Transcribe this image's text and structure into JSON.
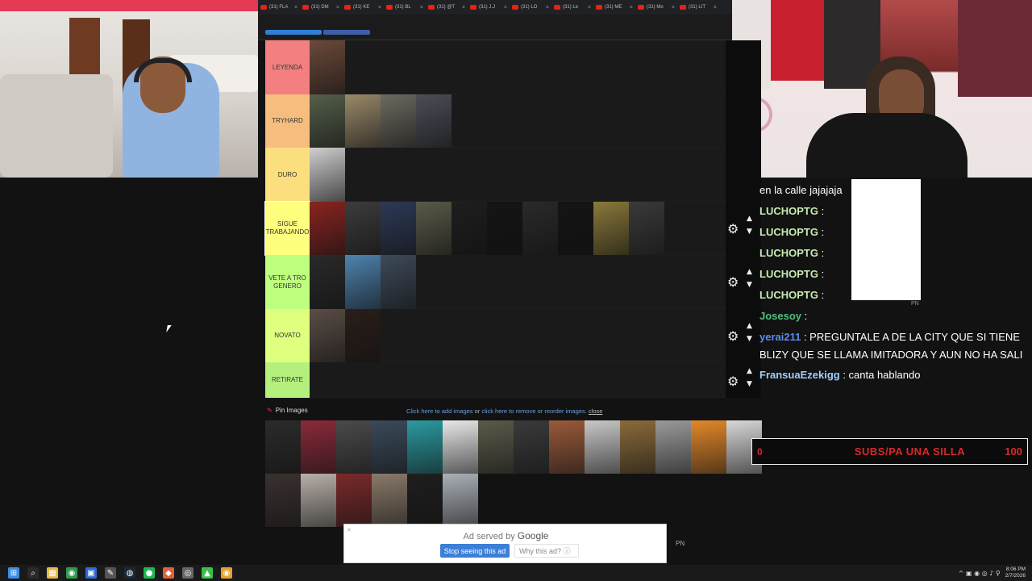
{
  "browser_tabs": [
    {
      "label": "(31) FLA"
    },
    {
      "label": "(31) DM"
    },
    {
      "label": "(31) KE"
    },
    {
      "label": "(31) BL"
    },
    {
      "label": "(31) @T"
    },
    {
      "label": "(31) J.J"
    },
    {
      "label": "(31) LO"
    },
    {
      "label": "(31) Le"
    },
    {
      "label": "(31) ME"
    },
    {
      "label": "(31) Mo"
    },
    {
      "label": "(31) LIT"
    }
  ],
  "tier_rows": [
    {
      "label": "LEYENDA",
      "color": "#f47f80",
      "thumbs": [
        "#6b4a3a"
      ]
    },
    {
      "label": "TRYHARD",
      "color": "#f7bd7f",
      "thumbs": [
        "#555f4a",
        "#9a8a6a",
        "#6d6a60",
        "#4c4e58"
      ]
    },
    {
      "label": "DURO",
      "color": "#fbdf7f",
      "thumbs": [
        "#cfcfcf"
      ]
    },
    {
      "label": "SIGUE TRABAJANDO",
      "color": "#ffff7f",
      "thumbs": [
        "#8a2420",
        "#3c3c3c",
        "#2d3a56",
        "#5a5a4a",
        "#1e1e1e",
        "#141414",
        "#2a2a2a",
        "#141414",
        "#8b7a3a",
        "#3a3a3a"
      ]
    },
    {
      "label": "VETE A TRO GENERO",
      "color": "#bfff7f",
      "thumbs": [
        "#2a2a2a",
        "#4e84b0",
        "#3e4a5a"
      ]
    },
    {
      "label": "NOVATO",
      "color": "#dfff7f",
      "thumbs": [
        "#5a4e46",
        "#2a1e1a"
      ]
    },
    {
      "label": "RETIRATE",
      "color": "#b5f07f",
      "thumbs": []
    }
  ],
  "pin_images": {
    "label": "Pin Images",
    "help_prefix": "Click here to add images",
    "help_or": " or ",
    "help_link": "click here to remove or reorder images.",
    "help_close": "close",
    "pool_thumbs": [
      "#2b2b2b",
      "#8a2a3a",
      "#4a4a4a",
      "#3a4a5a",
      "#2a9aa0",
      "#e8e8e8",
      "#5a5a4a",
      "#3a3a3a",
      "#9a5a3a",
      "#c8c8c8",
      "#8a6a3a",
      "#9a9a9a",
      "#e3882a",
      "#d8d8d8",
      "#3a3030",
      "#b8b0a8",
      "#7a2a2a",
      "#8a7a6a",
      "#1e1e1e",
      "#aab0b8"
    ]
  },
  "chat": {
    "lines": [
      {
        "user": "",
        "msg": "en la calle jajajaja",
        "user_color": "#ffffff"
      },
      {
        "user": "LUCHOPTG",
        "msg": " : ",
        "user_color": "#c5ecb1",
        "emote": true
      },
      {
        "user": "LUCHOPTG",
        "msg": " : ",
        "user_color": "#c5ecb1",
        "emote": true
      },
      {
        "user": "LUCHOPTG",
        "msg": " : ",
        "user_color": "#c5ecb1",
        "emote": true
      },
      {
        "user": "LUCHOPTG",
        "msg": " : ",
        "user_color": "#c5ecb1",
        "emote": true
      },
      {
        "user": "LUCHOPTG",
        "msg": " : ",
        "user_color": "#c5ecb1",
        "emote": true
      },
      {
        "user": "Josesoy",
        "msg": " : ",
        "user_color": "#4fbf7f",
        "emote": true
      },
      {
        "user": "yerai211",
        "msg": " : PREGUNTALE A DE LA CITY QUE SI TIENE",
        "user_color": "#5a8cf0"
      },
      {
        "user": "",
        "msg": "BLIZY QUE SE LLAMA IMITADORA Y AUN NO HA SALI",
        "user_color": "#ffffff"
      },
      {
        "user": "FransuaEzekigg",
        "msg": " : canta hablando",
        "user_color": "#9ed0ff"
      }
    ],
    "pn": "PN"
  },
  "goal": {
    "left": "0",
    "text": "SUBS/PA UNA SILLA",
    "right": "100",
    "color": "#d9282b"
  },
  "ad": {
    "served_by": "Ad served by",
    "google": "Google",
    "stop_label": "Stop seeing this ad",
    "why_label": "Why this ad?",
    "info_icon": "ⓘ",
    "pn": "PN"
  },
  "taskbar": {
    "icons": [
      "start-icon",
      "search-icon",
      "file-explorer-icon",
      "chrome-icon",
      "app-icon",
      "pen-icon",
      "steam-icon",
      "spotify-icon",
      "brave-icon",
      "obs-icon",
      "game-icon",
      "chrome-canary-icon"
    ],
    "clock_time": "8:06 PM",
    "clock_date": "2/7/2026",
    "tray": "^ ▣ ◉ ◎ ♪ ⚲"
  }
}
